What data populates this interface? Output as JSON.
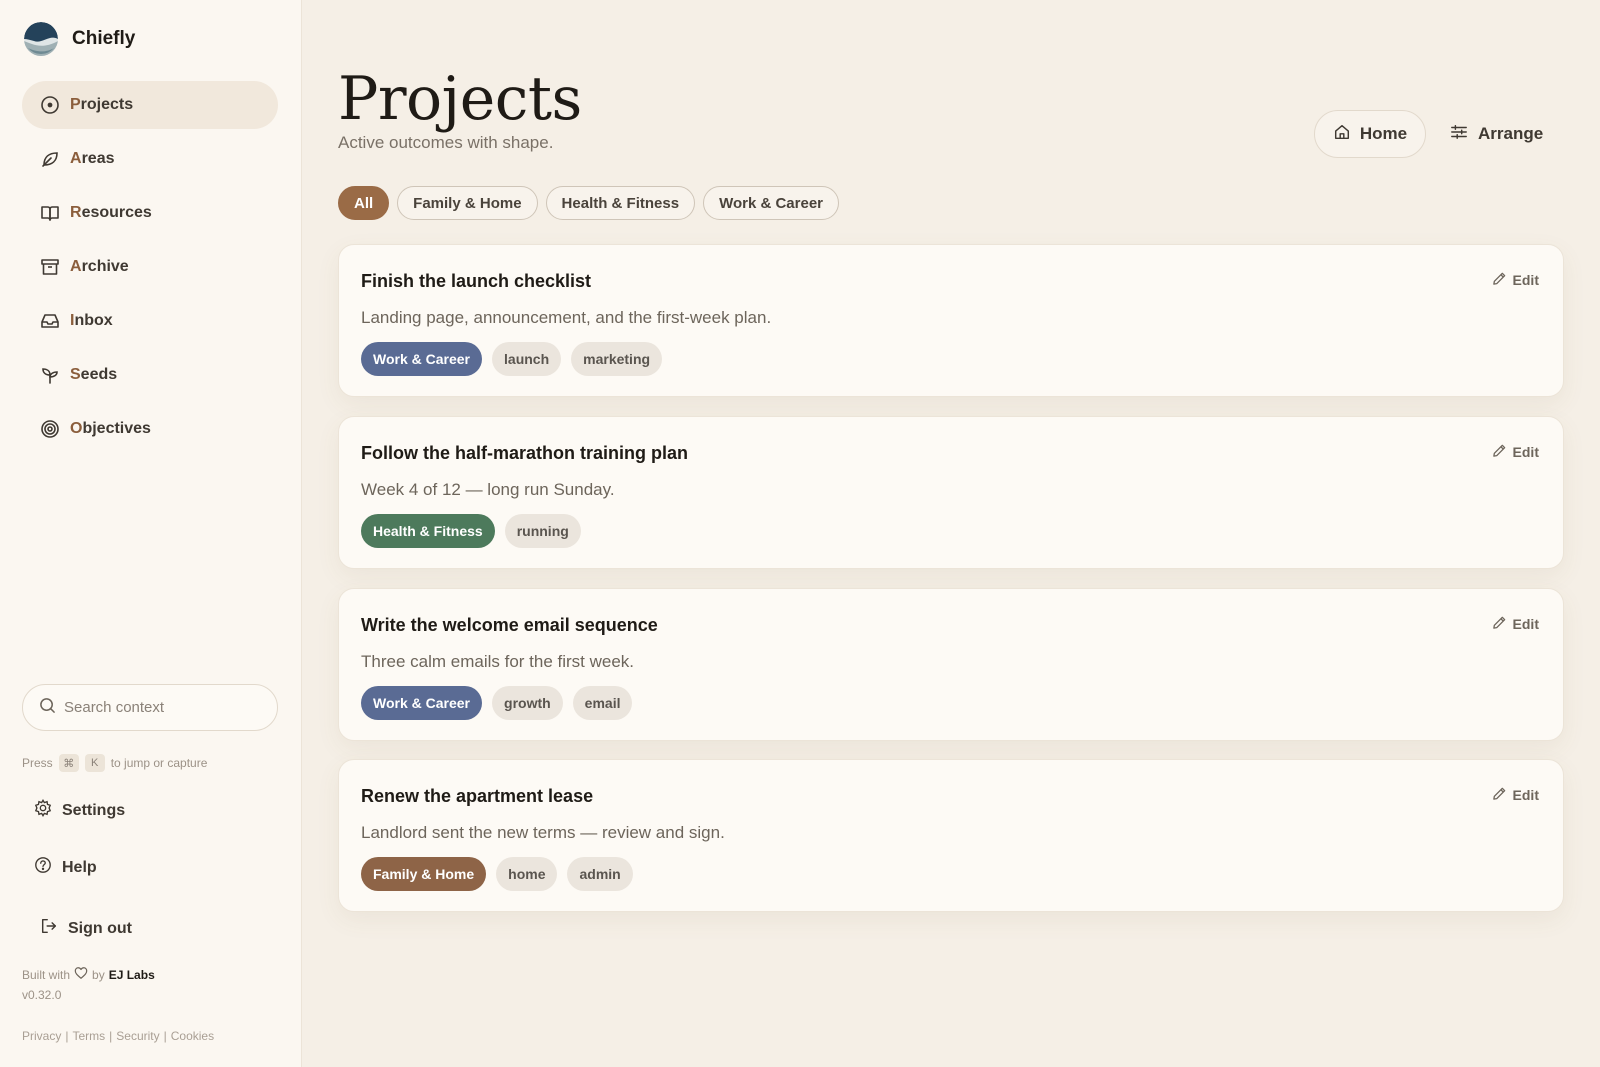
{
  "brand": {
    "name": "Chiefly"
  },
  "sidebar": {
    "items": [
      {
        "label": "Projects",
        "icon": "compass-icon",
        "active": true
      },
      {
        "label": "Areas",
        "icon": "leaf-icon",
        "active": false
      },
      {
        "label": "Resources",
        "icon": "book-icon",
        "active": false
      },
      {
        "label": "Archive",
        "icon": "archive-icon",
        "active": false
      },
      {
        "label": "Inbox",
        "icon": "inbox-icon",
        "active": false
      },
      {
        "label": "Seeds",
        "icon": "sprout-icon",
        "active": false
      },
      {
        "label": "Objectives",
        "icon": "target-icon",
        "active": false
      }
    ],
    "search": {
      "placeholder": "Search context"
    },
    "hint": {
      "press": "Press",
      "key1": "⌘",
      "key2": "K",
      "suffix": "to jump or capture"
    },
    "footer_items": [
      {
        "label": "Settings",
        "icon": "gear-icon"
      },
      {
        "label": "Help",
        "icon": "help-icon"
      },
      {
        "label": "Sign out",
        "icon": "sign-out-icon"
      }
    ],
    "built": {
      "prefix": "Built with",
      "by": "by",
      "company": "EJ Labs"
    },
    "version": "v0.32.0",
    "legal": [
      "Privacy",
      "Terms",
      "Security",
      "Cookies"
    ]
  },
  "header": {
    "title": "Projects",
    "subtitle": "Active outcomes with shape.",
    "home_label": "Home",
    "arrange_label": "Arrange"
  },
  "filters": [
    {
      "label": "All",
      "active": true
    },
    {
      "label": "Family & Home",
      "active": false
    },
    {
      "label": "Health & Fitness",
      "active": false
    },
    {
      "label": "Work & Career",
      "active": false
    }
  ],
  "colors": {
    "work_career": "#5a6b94",
    "health_fitness": "#4d7a5c",
    "family_home": "#8e6447",
    "accent": "#9a6b46"
  },
  "edit_label": "Edit",
  "projects": [
    {
      "title": "Finish the launch checklist",
      "description": "Landing page, announcement, and the first-week plan.",
      "category": "Work & Career",
      "category_color": "#5a6b94",
      "tags": [
        "launch",
        "marketing"
      ]
    },
    {
      "title": "Follow the half-marathon training plan",
      "description": "Week 4 of 12 — long run Sunday.",
      "category": "Health & Fitness",
      "category_color": "#4d7a5c",
      "tags": [
        "running"
      ]
    },
    {
      "title": "Write the welcome email sequence",
      "description": "Three calm emails for the first week.",
      "category": "Work & Career",
      "category_color": "#5a6b94",
      "tags": [
        "growth",
        "email"
      ]
    },
    {
      "title": "Renew the apartment lease",
      "description": "Landlord sent the new terms — review and sign.",
      "category": "Family & Home",
      "category_color": "#8e6447",
      "tags": [
        "home",
        "admin"
      ]
    }
  ]
}
